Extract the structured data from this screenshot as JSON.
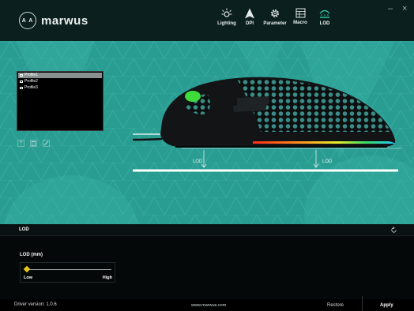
{
  "brand": {
    "logo_mark": "A A",
    "name": "marwus"
  },
  "nav": {
    "items": [
      {
        "label": "Lighting",
        "icon": "lighting-icon"
      },
      {
        "label": "DPI",
        "icon": "dpi-arrow-icon"
      },
      {
        "label": "Parameter",
        "icon": "gear-icon"
      },
      {
        "label": "Macro",
        "icon": "macro-grid-icon"
      },
      {
        "label": "LOD",
        "icon": "lod-icon",
        "active": true
      }
    ]
  },
  "window_controls": {
    "minimize": "–",
    "close": "×"
  },
  "profiles": {
    "items": [
      {
        "label": "Profile1",
        "selected": true
      },
      {
        "label": "Profile2",
        "selected": false
      },
      {
        "label": "Profile3",
        "selected": false
      }
    ],
    "tools": [
      "add-profile-icon",
      "delete-profile-icon",
      "edit-profile-icon"
    ]
  },
  "diagram": {
    "lod_label_left": "LOD",
    "lod_label_right": "LOD"
  },
  "settings": {
    "title": "LOD",
    "unit_label": "LOD (mm)",
    "slider": {
      "low_label": "Low",
      "high_label": "High",
      "value_fraction": 0.0
    }
  },
  "footer": {
    "driver_version": "Driver version: 1.0.6",
    "website": "www.marwus.com",
    "restore_label": "Restore",
    "apply_label": "Apply"
  },
  "colors": {
    "accent_teal": "#2a9d93",
    "header_bg": "#0b1f1e",
    "slider_thumb": "#e5c81a",
    "mouse_accent_green": "#3ddc3a"
  }
}
